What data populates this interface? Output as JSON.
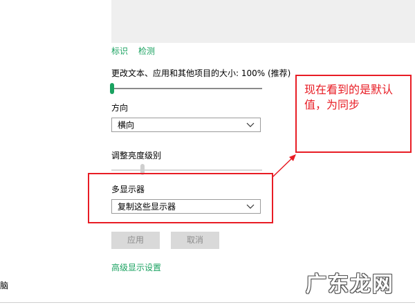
{
  "links": {
    "identify": "标识",
    "detect": "检测",
    "advanced": "高级显示设置"
  },
  "size": {
    "label": "更改文本、应用和其他项目的大小: 100% (推荐)",
    "level": 0.0
  },
  "orientation": {
    "label": "方向",
    "value": "横向"
  },
  "brightness": {
    "label": "调整亮度级别",
    "level": 0.2
  },
  "multi_display": {
    "label": "多显示器",
    "value": "复制这些显示器"
  },
  "buttons": {
    "apply": "应用",
    "cancel": "取消"
  },
  "left_partial_text": "脑",
  "annotation": {
    "note": "现在看到的是默认值，为同步",
    "color": "#e81c24"
  },
  "watermark": "广东龙网",
  "colors": {
    "accent": "#1aa260",
    "button_bg": "#d9d9d9",
    "button_text": "#8c8c8c"
  }
}
